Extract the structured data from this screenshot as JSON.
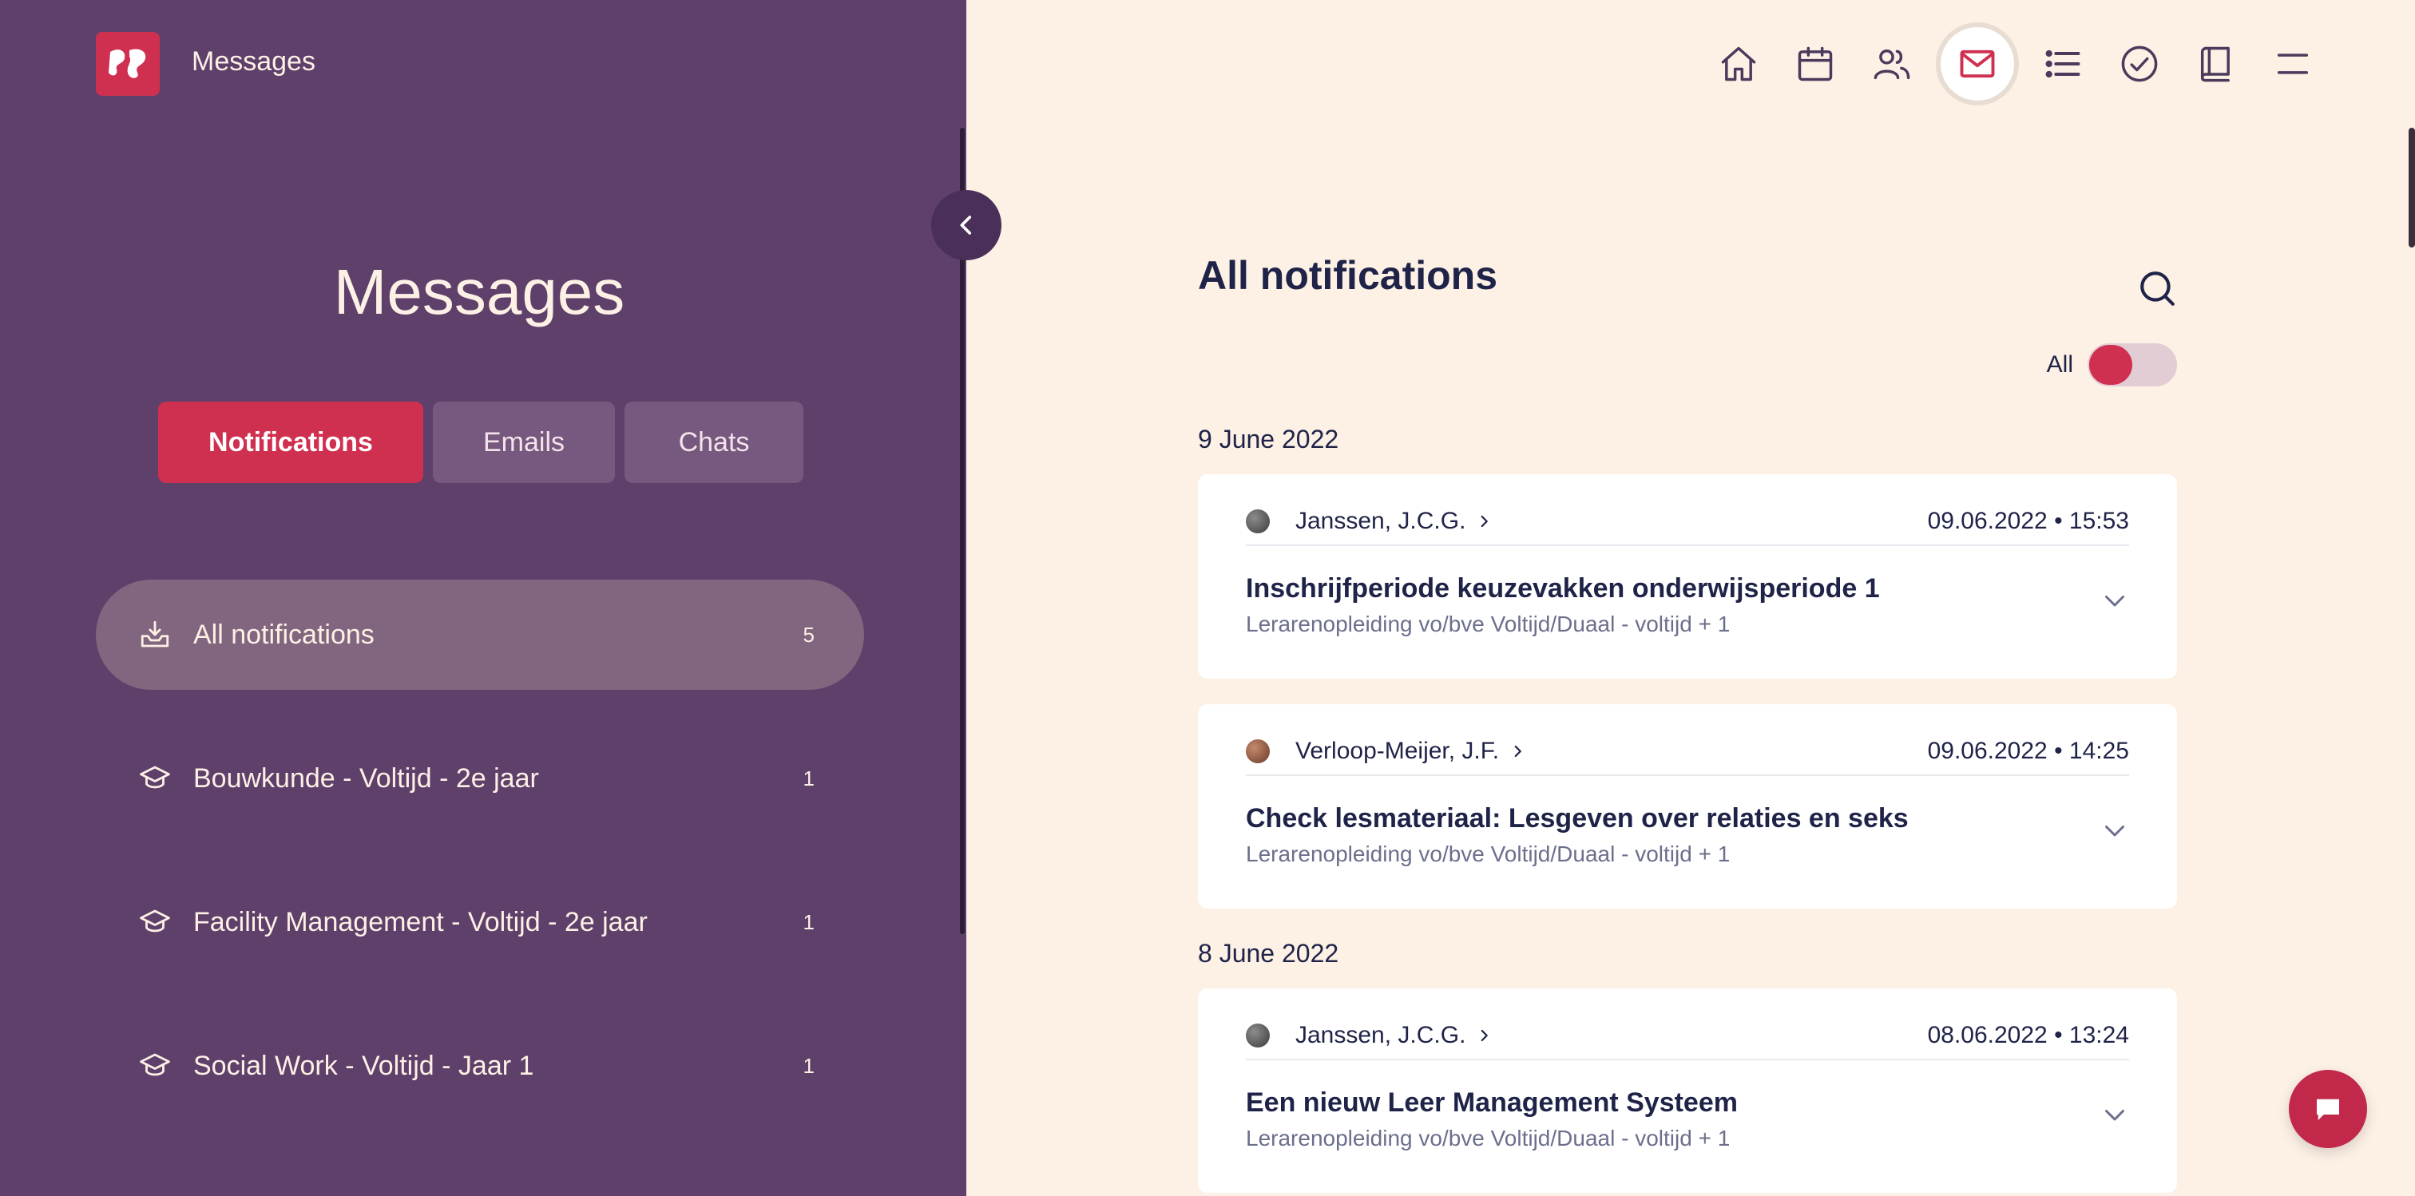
{
  "header": {
    "app_title": "Messages"
  },
  "sidebar": {
    "title": "Messages",
    "tabs": [
      {
        "label": "Notifications",
        "active": true
      },
      {
        "label": "Emails",
        "active": false
      },
      {
        "label": "Chats",
        "active": false
      }
    ],
    "categories": [
      {
        "label": "All notifications",
        "count": "5",
        "icon": "inbox-download-icon",
        "active": true
      },
      {
        "label": "Bouwkunde - Voltijd - 2e jaar",
        "count": "1",
        "icon": "graduation-cap-icon",
        "active": false
      },
      {
        "label": "Facility Management - Voltijd - 2e jaar",
        "count": "1",
        "icon": "graduation-cap-icon",
        "active": false
      },
      {
        "label": "Social Work - Voltijd - Jaar 1",
        "count": "1",
        "icon": "graduation-cap-icon",
        "active": false
      }
    ]
  },
  "topnav": {
    "items": [
      "home-icon",
      "calendar-icon",
      "people-icon",
      "mail-icon",
      "list-icon",
      "check-circle-icon",
      "book-icon",
      "menu-icon"
    ],
    "active": "mail-icon"
  },
  "main": {
    "title": "All notifications",
    "filter_label": "All",
    "groups": [
      {
        "date": "9 June 2022",
        "items": [
          {
            "sender": "Janssen, J.C.G.",
            "timestamp": "09.06.2022 • 15:53",
            "subject": "Inschrijfperiode keuzevakken onderwijsperiode 1",
            "meta": "Lerarenopleiding vo/bve Voltijd/Duaal - voltijd + 1"
          },
          {
            "sender": "Verloop-Meijer, J.F.",
            "timestamp": "09.06.2022 • 14:25",
            "subject": "Check lesmateriaal: Lesgeven over relaties en seks",
            "meta": "Lerarenopleiding vo/bve Voltijd/Duaal - voltijd + 1"
          }
        ]
      },
      {
        "date": "8 June 2022",
        "items": [
          {
            "sender": "Janssen, J.C.G.",
            "timestamp": "08.06.2022 • 13:24",
            "subject": "Een nieuw Leer Management Systeem",
            "meta": "Lerarenopleiding vo/bve Voltijd/Duaal - voltijd + 1"
          }
        ]
      }
    ]
  },
  "colors": {
    "sidebar_bg": "#5e406b",
    "accent": "#d0304f",
    "page_bg": "#fdf0e5",
    "text_dark": "#1f2348"
  }
}
